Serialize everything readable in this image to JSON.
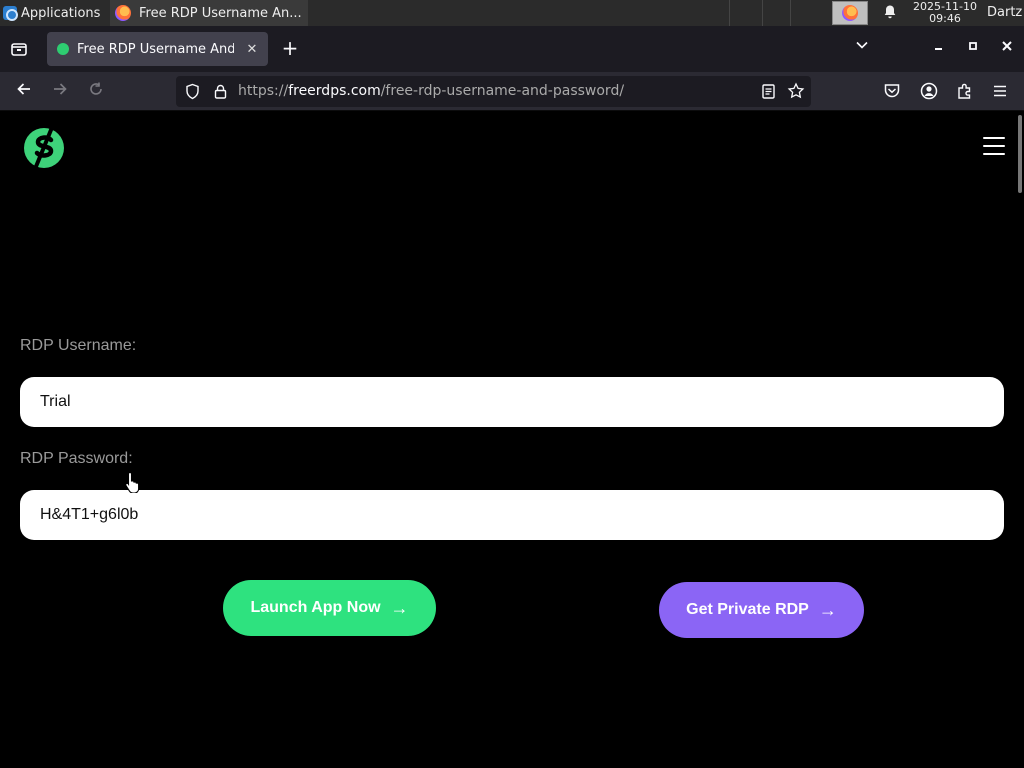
{
  "taskbar": {
    "applications_label": "Applications",
    "task_title": "Free RDP Username An...",
    "clock_date": "2025-11-10",
    "clock_time": "09:46",
    "user": "Dartz"
  },
  "browser": {
    "tab_title": "Free RDP Username And Password",
    "tab_close": "✕",
    "new_tab": "+",
    "url_prefix": "https://",
    "url_domain": "freerdps.com",
    "url_path": "/free-rdp-username-and-password/"
  },
  "page": {
    "username_label": "RDP Username:",
    "username_value": "Trial",
    "password_label": "RDP Password:",
    "password_value": "H&4T1+g6l0b",
    "launch_button": "Launch App Now",
    "private_button": "Get Private RDP",
    "arrow": "→"
  },
  "colors": {
    "launch": "#2ee27f",
    "private": "#8b65f5",
    "logo_green": "#3ed27a"
  },
  "icons": [
    "firefox-icon",
    "bell-icon",
    "shield-icon",
    "lock-icon",
    "reader-view-icon",
    "star-icon",
    "pocket-icon",
    "account-icon",
    "extensions-icon",
    "app-menu-icon",
    "hamburger-menu-icon"
  ]
}
